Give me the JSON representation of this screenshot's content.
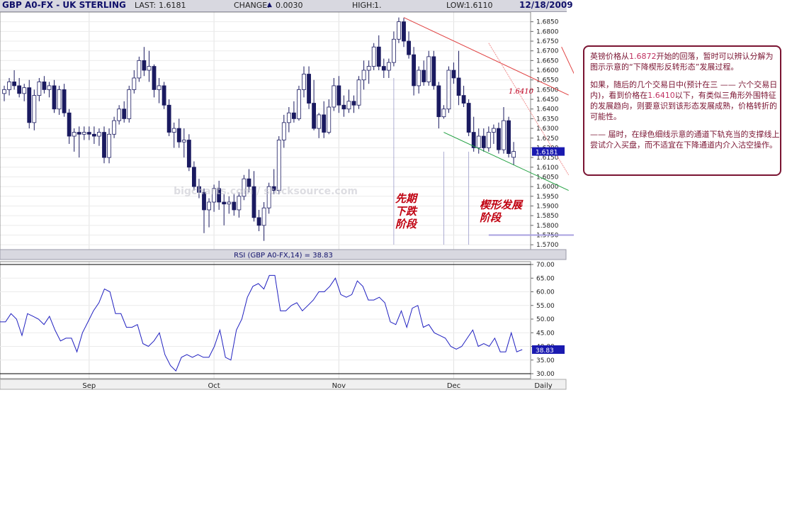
{
  "header": {
    "symbol": "GBP A0-FX - UK STERLING",
    "last_label": "LAST:",
    "last_value": "1.6181",
    "change_label": "CHANGE:",
    "change_arrow": "▲",
    "change_value": "0.0030",
    "high_label": "HIGH:",
    "high_value": "1.",
    "low_label": "LOW:",
    "low_value": "1.6110",
    "date": "12/18/2009"
  },
  "chart_data": [
    {
      "type": "candlestick",
      "ylim": [
        1.5675,
        1.69
      ],
      "y_ticks": [
        "1.6850",
        "1.6800",
        "1.6750",
        "1.6700",
        "1.6650",
        "1.6600",
        "1.6550",
        "1.6500",
        "1.6450",
        "1.6400",
        "1.6350",
        "1.6300",
        "1.6250",
        "1.6200",
        "1.6150",
        "1.6100",
        "1.6050",
        "1.6000",
        "1.5950",
        "1.5900",
        "1.5850",
        "1.5800",
        "1.5750",
        "1.5700"
      ],
      "x_labels": [
        "Sep",
        "Oct",
        "Nov",
        "Dec"
      ],
      "period": "Daily",
      "last_price": "1.6181",
      "colors": {
        "up": "#ffffff",
        "down": "#1a1a60",
        "channel_upper": "#e04040",
        "channel_lower": "#20a040"
      },
      "annotations": {
        "top_price": "1.6872",
        "mid_price": "1.6410"
      },
      "candles": [
        [
          1.648,
          1.652,
          1.644,
          1.65
        ],
        [
          1.65,
          1.656,
          1.647,
          1.654
        ],
        [
          1.654,
          1.66,
          1.65,
          1.652
        ],
        [
          1.652,
          1.656,
          1.646,
          1.648
        ],
        [
          1.648,
          1.653,
          1.644,
          1.651
        ],
        [
          1.651,
          1.655,
          1.63,
          1.633
        ],
        [
          1.633,
          1.65,
          1.629,
          1.647
        ],
        [
          1.647,
          1.656,
          1.644,
          1.654
        ],
        [
          1.654,
          1.657,
          1.648,
          1.65
        ],
        [
          1.65,
          1.654,
          1.646,
          1.652
        ],
        [
          1.652,
          1.655,
          1.638,
          1.64
        ],
        [
          1.64,
          1.652,
          1.637,
          1.65
        ],
        [
          1.65,
          1.653,
          1.636,
          1.638
        ],
        [
          1.638,
          1.64,
          1.622,
          1.626
        ],
        [
          1.626,
          1.63,
          1.618,
          1.628
        ],
        [
          1.628,
          1.631,
          1.615,
          1.627
        ],
        [
          1.627,
          1.631,
          1.624,
          1.628
        ],
        [
          1.628,
          1.631,
          1.624,
          1.627
        ],
        [
          1.627,
          1.631,
          1.622,
          1.626
        ],
        [
          1.626,
          1.63,
          1.621,
          1.628
        ],
        [
          1.628,
          1.631,
          1.612,
          1.615
        ],
        [
          1.615,
          1.63,
          1.612,
          1.627
        ],
        [
          1.627,
          1.636,
          1.625,
          1.634
        ],
        [
          1.634,
          1.642,
          1.632,
          1.64
        ],
        [
          1.64,
          1.644,
          1.633,
          1.635
        ],
        [
          1.635,
          1.652,
          1.633,
          1.65
        ],
        [
          1.65,
          1.66,
          1.648,
          1.656
        ],
        [
          1.656,
          1.667,
          1.654,
          1.665
        ],
        [
          1.665,
          1.672,
          1.657,
          1.66
        ],
        [
          1.66,
          1.67,
          1.654,
          1.662
        ],
        [
          1.662,
          1.663,
          1.646,
          1.65
        ],
        [
          1.65,
          1.656,
          1.643,
          1.652
        ],
        [
          1.652,
          1.654,
          1.64,
          1.642
        ],
        [
          1.642,
          1.645,
          1.626,
          1.628
        ],
        [
          1.628,
          1.633,
          1.62,
          1.63
        ],
        [
          1.63,
          1.635,
          1.62,
          1.623
        ],
        [
          1.623,
          1.63,
          1.615,
          1.624
        ],
        [
          1.624,
          1.627,
          1.608,
          1.61
        ],
        [
          1.61,
          1.613,
          1.598,
          1.6
        ],
        [
          1.6,
          1.604,
          1.594,
          1.597
        ],
        [
          1.597,
          1.599,
          1.576,
          1.588
        ],
        [
          1.588,
          1.594,
          1.579,
          1.592
        ],
        [
          1.592,
          1.601,
          1.587,
          1.599
        ],
        [
          1.599,
          1.603,
          1.588,
          1.592
        ],
        [
          1.592,
          1.596,
          1.58,
          1.591
        ],
        [
          1.591,
          1.595,
          1.586,
          1.592
        ],
        [
          1.592,
          1.596,
          1.585,
          1.588
        ],
        [
          1.588,
          1.597,
          1.584,
          1.595
        ],
        [
          1.595,
          1.606,
          1.593,
          1.604
        ],
        [
          1.604,
          1.609,
          1.597,
          1.6
        ],
        [
          1.6,
          1.608,
          1.582,
          1.584
        ],
        [
          1.584,
          1.588,
          1.577,
          1.58
        ],
        [
          1.58,
          1.592,
          1.572,
          1.589
        ],
        [
          1.589,
          1.602,
          1.586,
          1.6
        ],
        [
          1.6,
          1.609,
          1.596,
          1.598
        ],
        [
          1.598,
          1.626,
          1.596,
          1.624
        ],
        [
          1.624,
          1.637,
          1.62,
          1.633
        ],
        [
          1.633,
          1.641,
          1.628,
          1.638
        ],
        [
          1.638,
          1.644,
          1.633,
          1.635
        ],
        [
          1.635,
          1.652,
          1.634,
          1.65
        ],
        [
          1.65,
          1.662,
          1.646,
          1.658
        ],
        [
          1.658,
          1.662,
          1.64,
          1.643
        ],
        [
          1.643,
          1.655,
          1.629,
          1.63
        ],
        [
          1.63,
          1.638,
          1.625,
          1.637
        ],
        [
          1.637,
          1.644,
          1.625,
          1.628
        ],
        [
          1.628,
          1.645,
          1.627,
          1.641
        ],
        [
          1.641,
          1.656,
          1.639,
          1.652
        ],
        [
          1.652,
          1.657,
          1.638,
          1.642
        ],
        [
          1.642,
          1.647,
          1.636,
          1.64
        ],
        [
          1.64,
          1.65,
          1.638,
          1.644
        ],
        [
          1.644,
          1.647,
          1.638,
          1.642
        ],
        [
          1.642,
          1.657,
          1.64,
          1.655
        ],
        [
          1.655,
          1.665,
          1.65,
          1.66
        ],
        [
          1.66,
          1.665,
          1.653,
          1.662
        ],
        [
          1.662,
          1.674,
          1.66,
          1.672
        ],
        [
          1.672,
          1.678,
          1.66,
          1.662
        ],
        [
          1.662,
          1.666,
          1.656,
          1.66
        ],
        [
          1.66,
          1.666,
          1.656,
          1.664
        ],
        [
          1.664,
          1.68,
          1.662,
          1.676
        ],
        [
          1.676,
          1.6872,
          1.674,
          1.685
        ],
        [
          1.685,
          1.687,
          1.672,
          1.675
        ],
        [
          1.675,
          1.68,
          1.666,
          1.668
        ],
        [
          1.668,
          1.672,
          1.647,
          1.652
        ],
        [
          1.652,
          1.662,
          1.648,
          1.66
        ],
        [
          1.66,
          1.665,
          1.652,
          1.654
        ],
        [
          1.654,
          1.67,
          1.652,
          1.667
        ],
        [
          1.667,
          1.67,
          1.65,
          1.652
        ],
        [
          1.652,
          1.654,
          1.63,
          1.636
        ],
        [
          1.636,
          1.642,
          1.635,
          1.64
        ],
        [
          1.64,
          1.662,
          1.638,
          1.66
        ],
        [
          1.66,
          1.664,
          1.653,
          1.656
        ],
        [
          1.656,
          1.67,
          1.642,
          1.647
        ],
        [
          1.647,
          1.652,
          1.641,
          1.643
        ],
        [
          1.643,
          1.645,
          1.626,
          1.628
        ],
        [
          1.628,
          1.636,
          1.618,
          1.62
        ],
        [
          1.62,
          1.63,
          1.617,
          1.626
        ],
        [
          1.626,
          1.63,
          1.618,
          1.62
        ],
        [
          1.62,
          1.631,
          1.618,
          1.628
        ],
        [
          1.628,
          1.632,
          1.622,
          1.63
        ],
        [
          1.63,
          1.633,
          1.617,
          1.619
        ],
        [
          1.619,
          1.641,
          1.617,
          1.634
        ],
        [
          1.634,
          1.636,
          1.615,
          1.617
        ],
        [
          1.6151,
          1.623,
          1.611,
          1.6181
        ]
      ]
    },
    {
      "type": "line",
      "title": "RSI (GBP A0-FX,14) = 38.83",
      "ylim": [
        30,
        70
      ],
      "y_ticks": [
        "70.00",
        "65.00",
        "60.00",
        "55.00",
        "50.00",
        "45.00",
        "40.00",
        "35.00",
        "30.00"
      ],
      "last_value": "38.83",
      "color": "#2020c0",
      "values": [
        49,
        49,
        52,
        50,
        44,
        52,
        51,
        50,
        48,
        51,
        46,
        42,
        43,
        43,
        38,
        45,
        49,
        53,
        56,
        61,
        60,
        52,
        52,
        47,
        47,
        48,
        41,
        40,
        42,
        45,
        37,
        33,
        31,
        36,
        37,
        36,
        37,
        36,
        36,
        40,
        46,
        36,
        35,
        46,
        50,
        58,
        62,
        63,
        61,
        66,
        66,
        53,
        53,
        55,
        56,
        53,
        55,
        57,
        60,
        60,
        62,
        65,
        59,
        58,
        59,
        64,
        62,
        57,
        57,
        58,
        56,
        49,
        48,
        53,
        47,
        54,
        55,
        47,
        48,
        45,
        44,
        43,
        40,
        39,
        40,
        43,
        46,
        40,
        41,
        40,
        43,
        38,
        38,
        45,
        38,
        38.83
      ]
    }
  ],
  "note": {
    "p1a": "英镑价格从",
    "p1b": "1.6872",
    "p1c": "开始的回落，暂时可以辨认分解为图示示意的“下降楔形反转形态”发展过程。",
    "p2a": "如果，随后的几个交易日中(预计在三 —— 六个交易日内)，看到价格在",
    "p2b": "1.6410",
    "p2c": "以下，有类似三角形外围特征的发展趋向，则要意识到该形态发展成熟，价格转折的可能性。",
    "p3": "—— 届时，在绿色细线示意的通道下轨充当的支撑线上尝试介入买盘，而不适宜在下降通道内介入沽空操作。"
  },
  "stages": {
    "stage1": [
      "先期",
      "下跌",
      "阶段"
    ],
    "stage2": [
      "楔形发展",
      "阶段"
    ]
  },
  "watermark": "bigcharts.com / stocksource.com"
}
